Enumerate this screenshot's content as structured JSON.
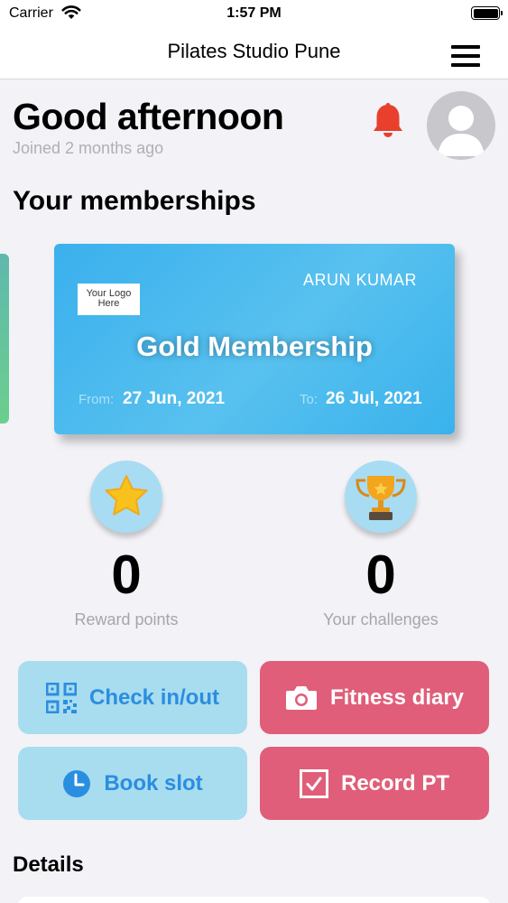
{
  "status_bar": {
    "carrier": "Carrier",
    "time": "1:57 PM"
  },
  "nav": {
    "title": "Pilates Studio Pune",
    "menu_icon": "hamburger-menu-icon"
  },
  "header": {
    "greeting": "Good afternoon",
    "joined": "Joined 2 months ago",
    "bell_icon": "bell-icon",
    "bell_color": "#e8402c"
  },
  "memberships": {
    "title": "Your memberships",
    "card": {
      "holder": "ARUN KUMAR",
      "logo_line1": "Your Logo",
      "logo_line2": "Here",
      "name": "Gold Membership",
      "from_label": "From:",
      "from_value": "27 Jun, 2021",
      "to_label": "To:",
      "to_value": "26 Jul, 2021"
    }
  },
  "stats": [
    {
      "icon": "star-icon",
      "value": "0",
      "label": "Reward points"
    },
    {
      "icon": "trophy-icon",
      "value": "0",
      "label": "Your challenges"
    }
  ],
  "actions": [
    {
      "icon": "qr-code-icon",
      "label": "Check in/out",
      "color": "#a8dcef"
    },
    {
      "icon": "camera-icon",
      "label": "Fitness diary",
      "color": "#e05e79"
    },
    {
      "icon": "clock-icon",
      "label": "Book slot",
      "color": "#a8dcef"
    },
    {
      "icon": "checkbox-icon",
      "label": "Record PT",
      "color": "#e05e79"
    }
  ],
  "details": {
    "title": "Details"
  }
}
